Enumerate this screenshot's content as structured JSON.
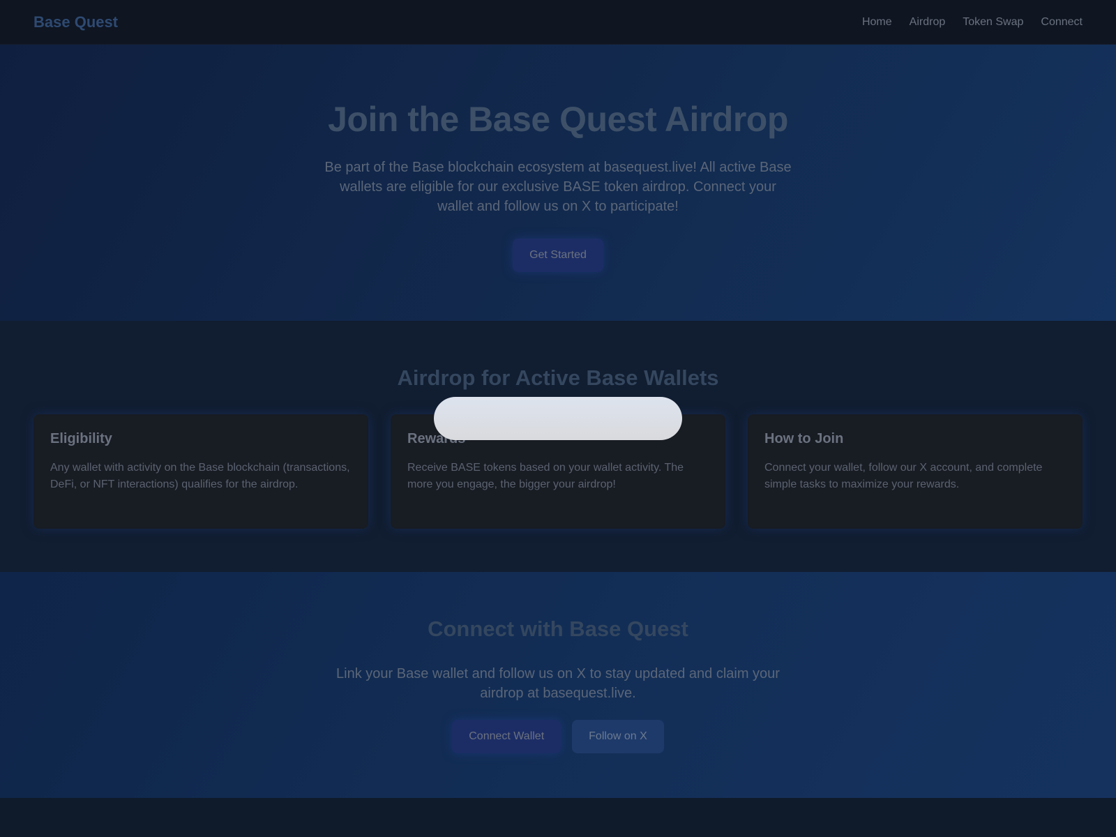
{
  "nav": {
    "logo": "Base Quest",
    "links": [
      "Home",
      "Airdrop",
      "Token Swap",
      "Connect"
    ]
  },
  "hero": {
    "title": "Join the Base Quest Airdrop",
    "text": "Be part of the Base blockchain ecosystem at basequest.live! All active Base wallets are eligible for our exclusive BASE token airdrop. Connect your wallet and follow us on X to participate!",
    "cta": "Get Started"
  },
  "features": {
    "title": "Airdrop for Active Base Wallets",
    "cards": [
      {
        "title": "Eligibility",
        "text": "Any wallet with activity on the Base blockchain (transactions, DeFi, or NFT interactions) qualifies for the airdrop."
      },
      {
        "title": "Rewards",
        "text": "Receive BASE tokens based on your wallet activity. The more you engage, the bigger your airdrop!"
      },
      {
        "title": "How to Join",
        "text": "Connect your wallet, follow our X account, and complete simple tasks to maximize your rewards."
      }
    ]
  },
  "connect": {
    "title": "Connect with Base Quest",
    "text": "Link your Base wallet and follow us on X to stay updated and claim your airdrop at basequest.live.",
    "connect_wallet": "Connect Wallet",
    "follow_x": "Follow on X"
  },
  "colors": {
    "overlay_pill": "#dde3ee",
    "primary_button": "#1c2d66"
  }
}
